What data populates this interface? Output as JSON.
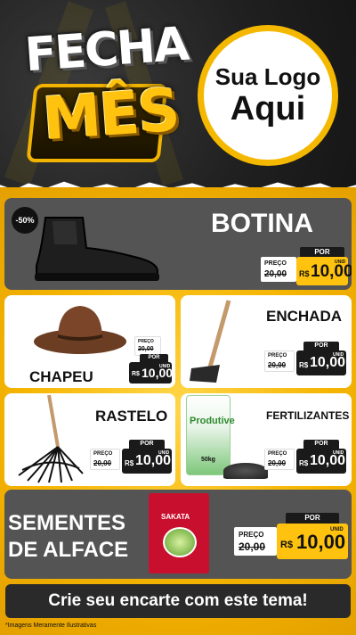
{
  "header": {
    "campaign_line1": "FECHA",
    "campaign_line2": "MÊS",
    "logo_line1": "Sua Logo",
    "logo_line2": "Aqui"
  },
  "products": [
    {
      "name": "BOTINA",
      "discount_badge": "-50%",
      "old_label": "PREÇO",
      "old_price": "20,00",
      "new_label": "POR",
      "currency": "R$",
      "new_price": "10,00",
      "unit": "UNID"
    },
    {
      "name": "CHAPEU",
      "old_label": "PREÇO",
      "old_price": "20,00",
      "new_label": "POR",
      "currency": "R$",
      "new_price": "10,00",
      "unit": "UNID"
    },
    {
      "name": "ENCHADA",
      "old_label": "PREÇO",
      "old_price": "20,00",
      "new_label": "POR",
      "currency": "R$",
      "new_price": "10,00",
      "unit": "UNID"
    },
    {
      "name": "RASTELO",
      "old_label": "PREÇO",
      "old_price": "20,00",
      "new_label": "POR",
      "currency": "R$",
      "new_price": "10,00",
      "unit": "UNID"
    },
    {
      "name": "FERTILIZANTES",
      "old_label": "PREÇO",
      "old_price": "20,00",
      "new_label": "POR",
      "currency": "R$",
      "new_price": "10,00",
      "unit": "UNID"
    },
    {
      "name_line1": "SEMENTES",
      "name_line2": "DE ALFACE",
      "old_label": "PREÇO",
      "old_price": "20,00",
      "new_label": "POR",
      "currency": "R$",
      "new_price": "10,00",
      "unit": "UNID"
    }
  ],
  "bag_labels": {
    "fertilizer_brand": "Produtive",
    "fertilizer_weight": "50kg",
    "seed_brand": "SAKATA"
  },
  "cta": "Crie seu encarte com este tema!",
  "footnote": "*Imagens Meramente Ilustrativas",
  "colors": {
    "accent": "#ffc20e",
    "dark": "#1a1a1a",
    "card_gray": "#545454"
  }
}
